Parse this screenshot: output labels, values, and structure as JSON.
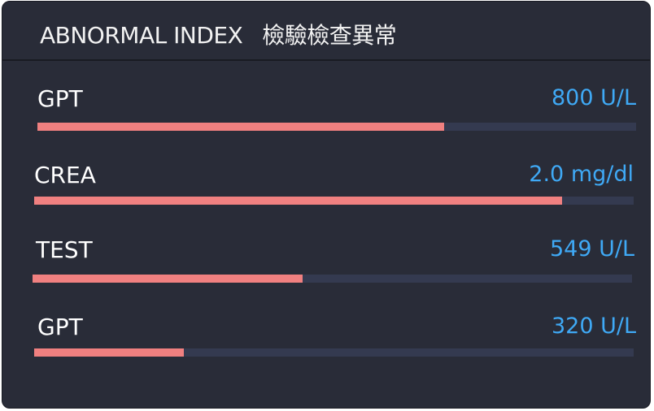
{
  "header": {
    "title": "ABNORMAL INDEX",
    "subtitle": "檢驗檢查異常"
  },
  "items": [
    {
      "label": "GPT",
      "value": "800 U/L",
      "level": 0.68,
      "bar_color": "#f08080"
    },
    {
      "label": "CREA",
      "value": "2.0 mg/dl",
      "level": 0.88,
      "bar_color": "#f08080"
    },
    {
      "label": "TEST",
      "value": "549 U/L",
      "level": 0.45,
      "bar_color": "#f08080"
    },
    {
      "label": "GPT",
      "value": "320 U/L",
      "level": 0.25,
      "bar_color": "#f08080"
    }
  ],
  "colors": {
    "background": "#292c38",
    "track": "#343a50",
    "fill": "#f08080",
    "value_text": "#3fa9f5",
    "label_text": "#ffffff"
  }
}
